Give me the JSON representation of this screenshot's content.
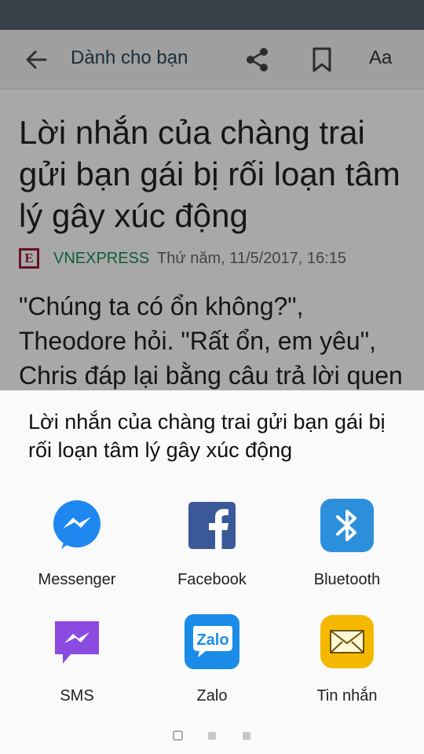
{
  "app_bar": {
    "back_icon": "arrow-left-icon",
    "title": "Dành cho bạn",
    "share_icon": "share-icon",
    "bookmark_icon": "bookmark-icon",
    "font_size_label": "Aa"
  },
  "article": {
    "headline": "Lời nhắn của chàng trai gửi bạn gái bị rối loạn tâm lý gây xúc động",
    "source_logo": "E",
    "source": "VNEXPRESS",
    "date": "Thứ năm, 11/5/2017, 16:15",
    "body": "\"Chúng ta có ổn không?\", Theodore hỏi. \"Rất ổn, em yêu\", Chris đáp lại bằng câu trả lời quen thuộc."
  },
  "share_sheet": {
    "title": "Lời nhắn của chàng trai gửi bạn gái bị rối loạn tâm lý gây xúc động",
    "apps": [
      {
        "label": "Messenger",
        "icon": "messenger-icon"
      },
      {
        "label": "Facebook",
        "icon": "facebook-icon"
      },
      {
        "label": "Bluetooth",
        "icon": "bluetooth-icon"
      },
      {
        "label": "SMS",
        "icon": "sms-icon"
      },
      {
        "label": "Zalo",
        "icon": "zalo-icon",
        "icon_text": "Zalo"
      },
      {
        "label": "Tin nhắn",
        "icon": "message-envelope-icon"
      }
    ],
    "pager": {
      "pages": 3,
      "current": 1
    }
  },
  "colors": {
    "status_bar": "#37414a",
    "source_green": "#1a8a5a",
    "source_logo": "#9d1c3a",
    "messenger_blue": "#1e88f0",
    "facebook_blue": "#3b5998",
    "bluetooth_blue": "#2b8fdc",
    "sms_purple": "#8b4be0",
    "zalo_blue": "#1a8ce8",
    "message_yellow": "#f5b800"
  }
}
